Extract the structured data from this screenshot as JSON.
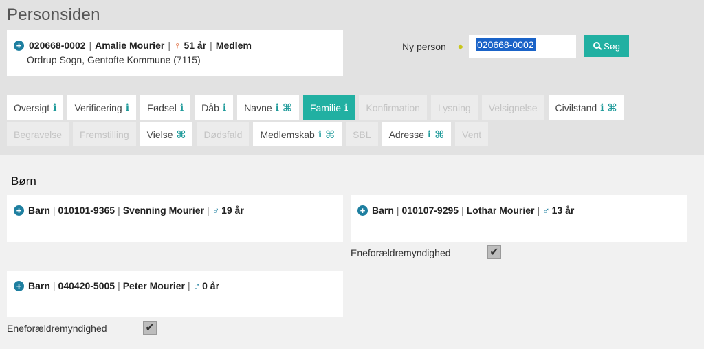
{
  "page": {
    "title": "Personsiden"
  },
  "person": {
    "cpr": "020668-0002",
    "name": "Amalie Mourier",
    "age": "51 år",
    "status": "Medlem",
    "parish": "Ordrup Sogn, Gentofte Kommune (7115)",
    "gender_icon": "female-icon"
  },
  "search": {
    "label": "Ny person",
    "value": "020668-0002",
    "button_label": "Søg"
  },
  "tabs_row1": [
    {
      "label": "Oversigt",
      "info": true,
      "cmd": false,
      "state": "normal"
    },
    {
      "label": "Verificering",
      "info": true,
      "cmd": false,
      "state": "normal"
    },
    {
      "label": "Fødsel",
      "info": true,
      "cmd": false,
      "state": "normal"
    },
    {
      "label": "Dåb",
      "info": true,
      "cmd": false,
      "state": "normal"
    },
    {
      "label": "Navne",
      "info": true,
      "cmd": true,
      "state": "normal"
    },
    {
      "label": "Familie",
      "info": true,
      "cmd": false,
      "state": "active"
    },
    {
      "label": "Konfirmation",
      "info": false,
      "cmd": false,
      "state": "disabled"
    },
    {
      "label": "Lysning",
      "info": false,
      "cmd": false,
      "state": "disabled"
    },
    {
      "label": "Velsignelse",
      "info": false,
      "cmd": false,
      "state": "disabled"
    },
    {
      "label": "Civilstand",
      "info": true,
      "cmd": true,
      "state": "normal"
    }
  ],
  "tabs_row2": [
    {
      "label": "Begravelse",
      "info": false,
      "cmd": false,
      "state": "disabled"
    },
    {
      "label": "Fremstilling",
      "info": false,
      "cmd": false,
      "state": "disabled"
    },
    {
      "label": "Vielse",
      "info": false,
      "cmd": true,
      "state": "normal"
    },
    {
      "label": "Dødsfald",
      "info": false,
      "cmd": false,
      "state": "disabled"
    },
    {
      "label": "Medlemskab",
      "info": true,
      "cmd": true,
      "state": "normal"
    },
    {
      "label": "SBL",
      "info": false,
      "cmd": false,
      "state": "disabled"
    },
    {
      "label": "Adresse",
      "info": true,
      "cmd": true,
      "state": "normal"
    },
    {
      "label": "Vent",
      "info": false,
      "cmd": false,
      "state": "disabled"
    }
  ],
  "icons": {
    "info": "i",
    "cmd": "⌘",
    "plus": "+",
    "female": "♀",
    "male": "♂",
    "diamond": "◆",
    "check": "✔"
  },
  "section": {
    "title": "Børn"
  },
  "children": [
    {
      "role": "Barn",
      "cpr": "010101-9365",
      "name": "Svenning Mourier",
      "age": "19 år",
      "custody_label": "",
      "custody_checked": false
    },
    {
      "role": "Barn",
      "cpr": "010107-9295",
      "name": "Lothar Mourier",
      "age": "13 år",
      "custody_label": "Eneforældremyndighed",
      "custody_checked": true
    },
    {
      "role": "Barn",
      "cpr": "040420-5005",
      "name": "Peter Mourier",
      "age": "0 år",
      "custody_label": "Eneforældremyndighed",
      "custody_checked": true
    }
  ],
  "colors": {
    "accent": "#21b0a2",
    "plus": "#1e7fa0",
    "female": "#d9531e",
    "male": "#1e7fa0"
  }
}
